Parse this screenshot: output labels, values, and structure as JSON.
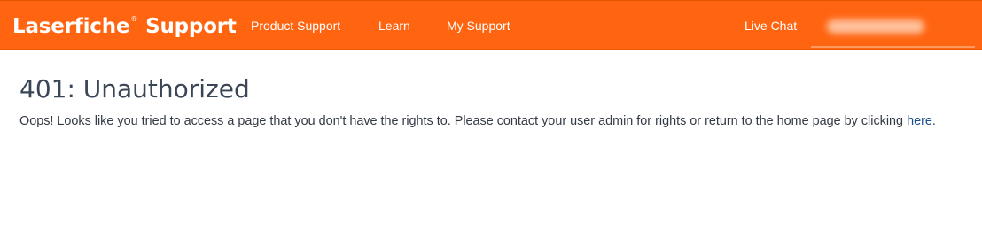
{
  "header": {
    "brand_name": "Laserfiche",
    "brand_reg": "®",
    "brand_suffix": "Support",
    "nav": {
      "product_support": "Product Support",
      "learn": "Learn",
      "my_support": "My Support",
      "live_chat": "Live Chat"
    },
    "colors": {
      "bar": "#ff6410",
      "text": "#ffffff"
    }
  },
  "main": {
    "title": "401: Unauthorized",
    "message_before_link": "Oops! Looks like you tried to access a page that you don't have the rights to. Please contact your user admin for rights or return to the home page by clicking ",
    "link_text": "here",
    "message_after_link": "."
  }
}
